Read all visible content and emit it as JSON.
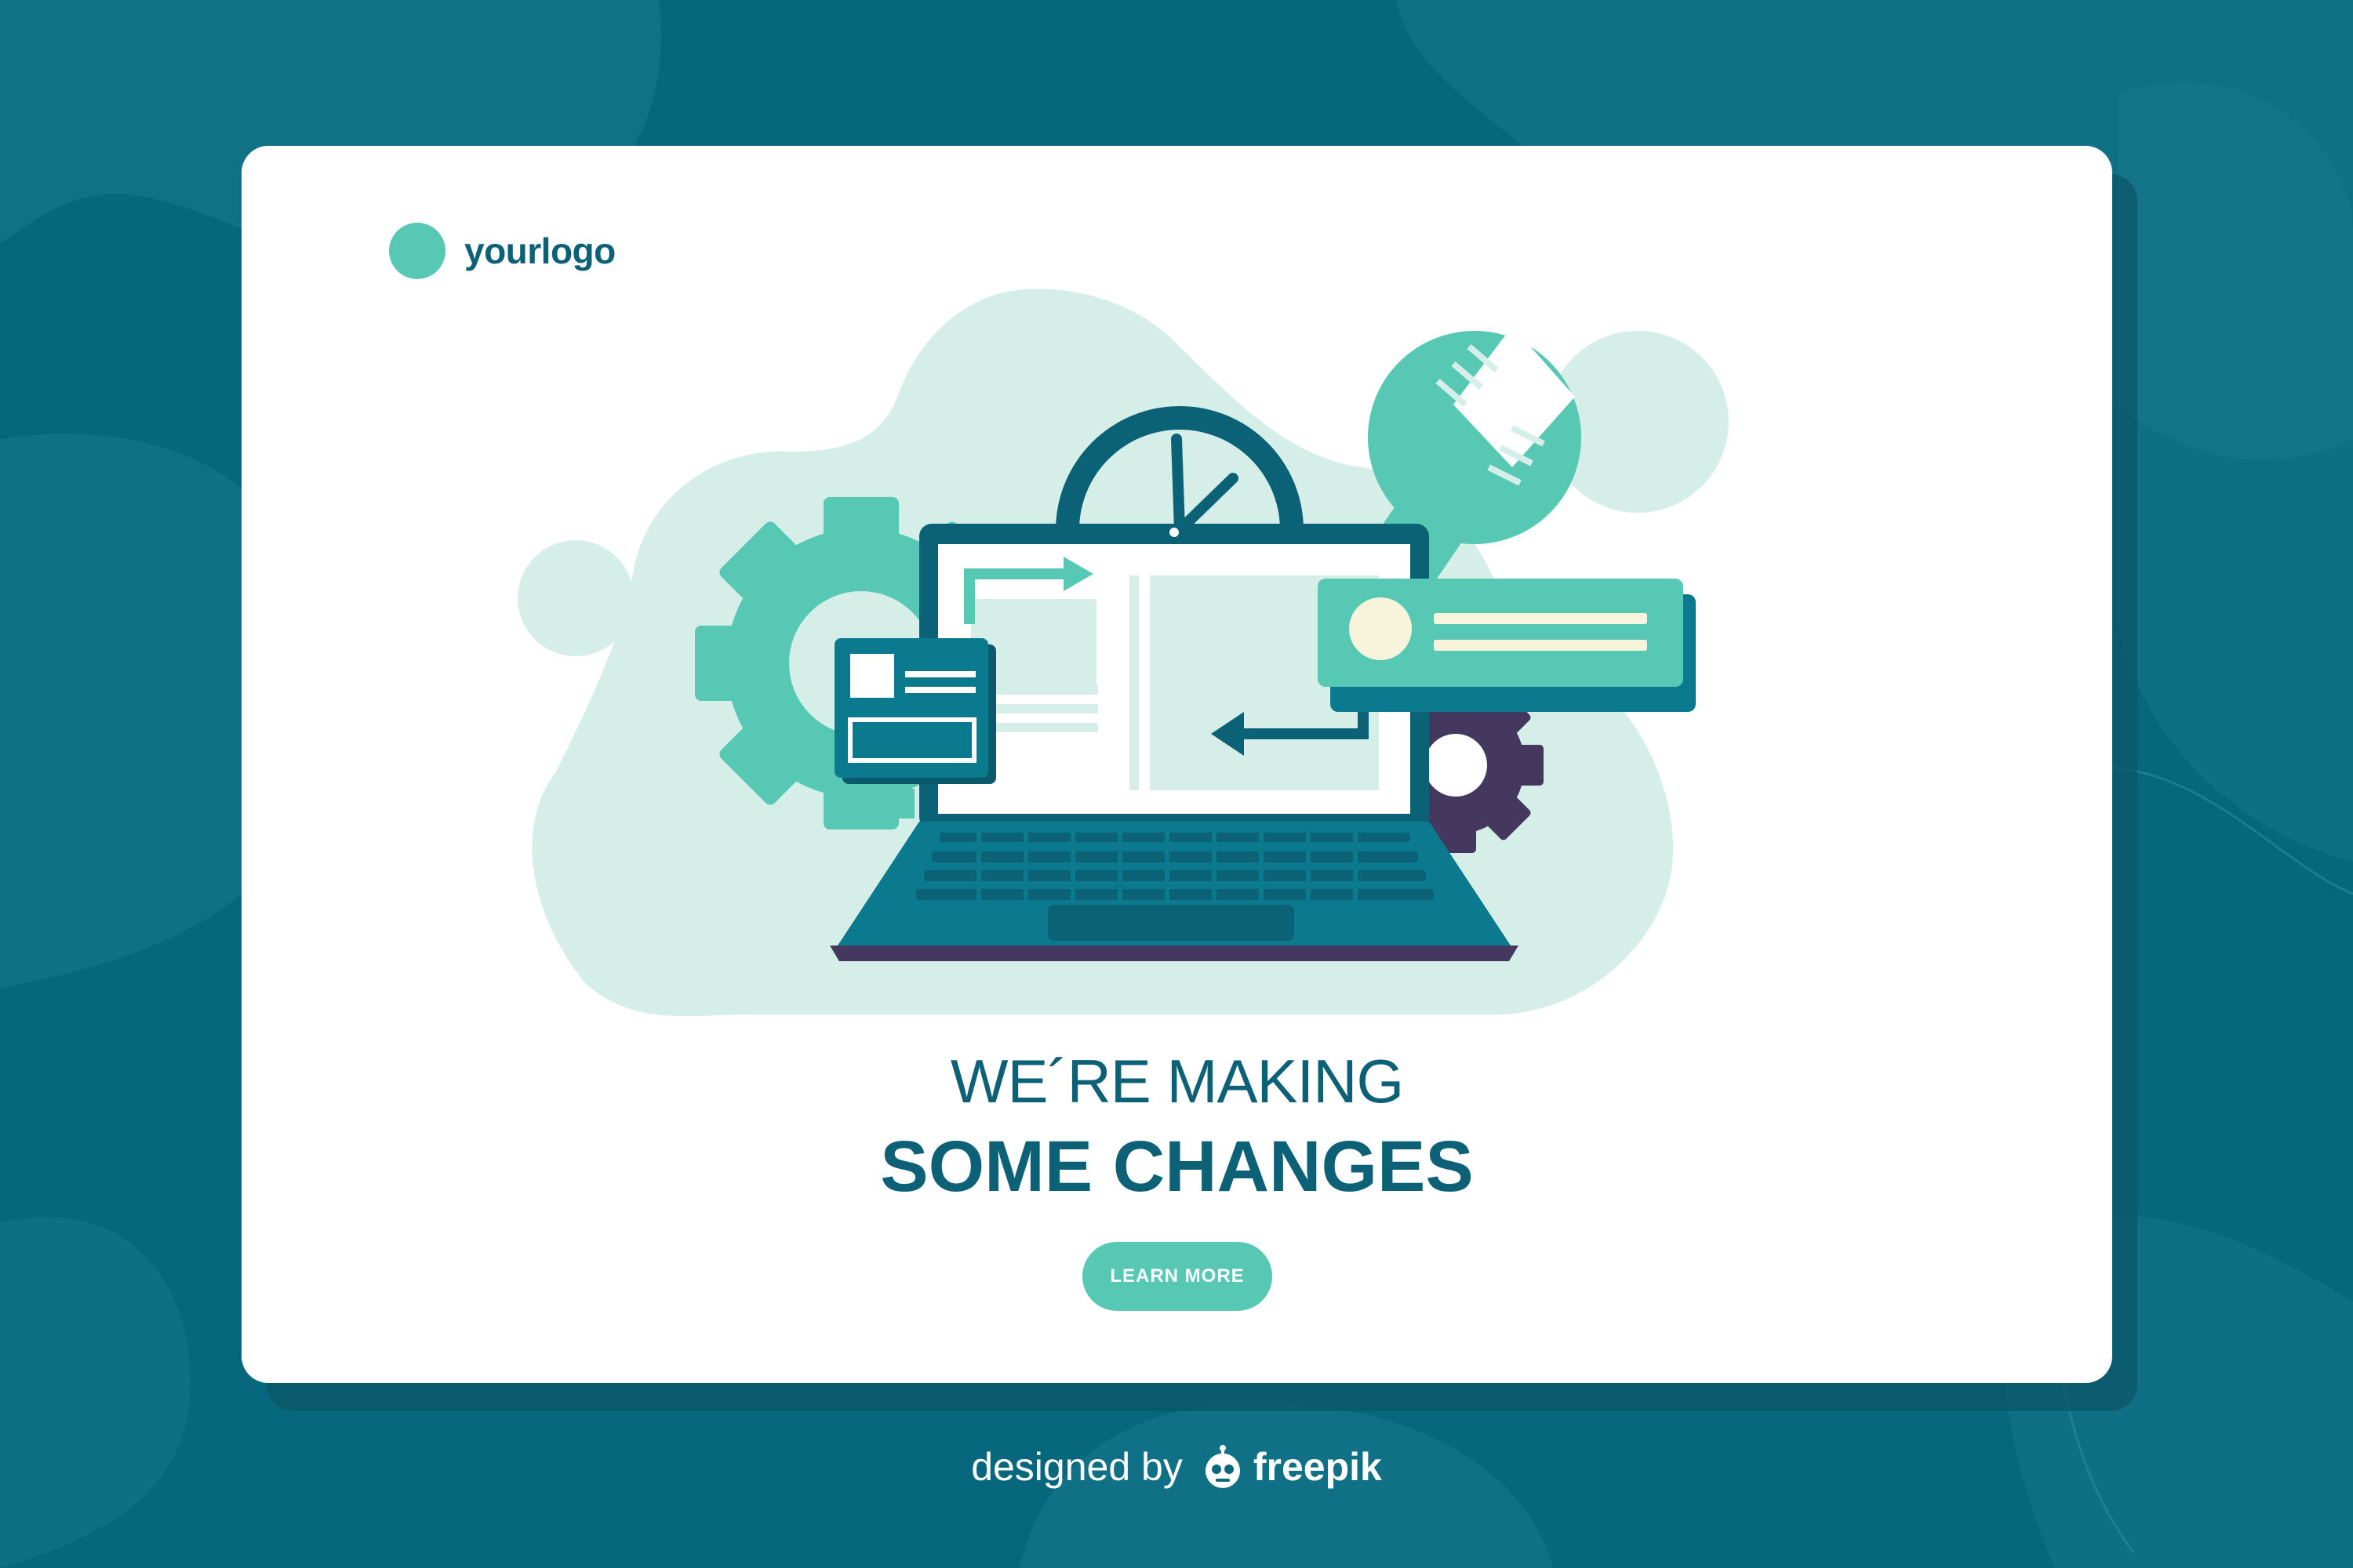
{
  "brand": {
    "logo_text": "yourlogo"
  },
  "hero": {
    "heading": "WE´RE MAKING",
    "subheading": "SOME CHANGES",
    "cta_label": "LEARN MORE"
  },
  "footer": {
    "prefix": "designed by",
    "brand": "freepik"
  },
  "icons": {
    "logo": "circle-logo-icon",
    "gear_large": "gear-icon",
    "gear_small": "gear-icon",
    "clock": "clock-icon",
    "wrench": "wrench-icon",
    "laptop": "laptop-icon",
    "arrows": "arrow-icon",
    "freepik": "robot-icon"
  },
  "colors": {
    "background": "#07687d",
    "card": "#ffffff",
    "mint": "#56c8b3",
    "pale_mint": "#d5efe8",
    "dark_teal": "#0b6276",
    "deep_purple": "#44385f",
    "heading": "#0d6177",
    "cta": "#56c8b3"
  }
}
